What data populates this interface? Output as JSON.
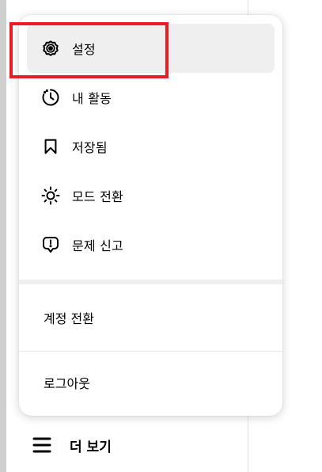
{
  "menu": {
    "items": [
      {
        "label": "설정",
        "icon": "gear-icon",
        "active": true
      },
      {
        "label": "내 활동",
        "icon": "activity-clock-icon",
        "active": false
      },
      {
        "label": "저장됨",
        "icon": "bookmark-icon",
        "active": false
      },
      {
        "label": "모드 전환",
        "icon": "sun-icon",
        "active": false
      },
      {
        "label": "문제 신고",
        "icon": "report-problem-icon",
        "active": false
      }
    ],
    "switch_account_label": "계정 전환",
    "logout_label": "로그아웃"
  },
  "more": {
    "label": "더 보기",
    "icon": "hamburger-menu-icon"
  },
  "colors": {
    "highlight": "#ea1c24",
    "active_item_bg": "#efefef"
  }
}
